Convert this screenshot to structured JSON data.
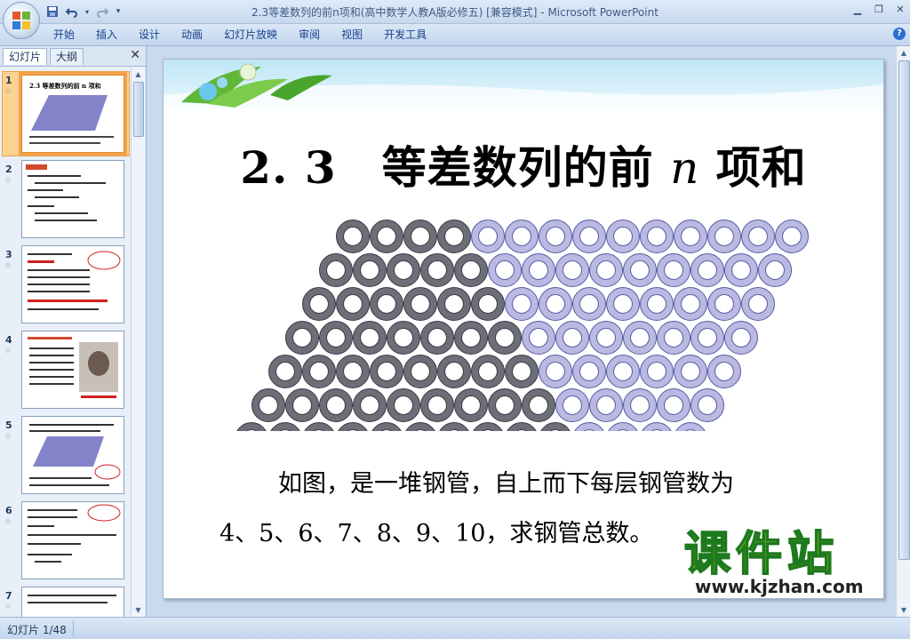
{
  "window": {
    "title": "2.3等差数列的前n项和(高中数学人教A版必修五) [兼容模式] - Microsoft PowerPoint"
  },
  "ribbon": {
    "tabs": [
      "开始",
      "插入",
      "设计",
      "动画",
      "幻灯片放映",
      "审阅",
      "视图",
      "开发工具"
    ]
  },
  "left_panel": {
    "tab_slides": "幻灯片",
    "tab_outline": "大纲",
    "thumbnails": [
      {
        "num": "1",
        "selected": true
      },
      {
        "num": "2"
      },
      {
        "num": "3"
      },
      {
        "num": "4"
      },
      {
        "num": "5"
      },
      {
        "num": "6"
      },
      {
        "num": "7"
      }
    ]
  },
  "slide": {
    "title_prefix": "2. 3　等差数列的前",
    "title_var": "n",
    "title_suffix": "项和",
    "body_line1": "如图，是一堆钢管，自上而下每层钢管数为",
    "body_line2": "4、5、6、7、8、9、10，求钢管总数。",
    "pipe_rows_dark": [
      4,
      5,
      6,
      7,
      8,
      9,
      10
    ],
    "pipe_rows_light": [
      10,
      9,
      8,
      7,
      6,
      5,
      4
    ],
    "dark_color": "#6e6e78",
    "light_color": "#b9b9e2"
  },
  "watermark": {
    "cn": "课件站",
    "url": "www.kjzhan.com"
  },
  "status": {
    "slide_counter": "幻灯片 1/48"
  }
}
